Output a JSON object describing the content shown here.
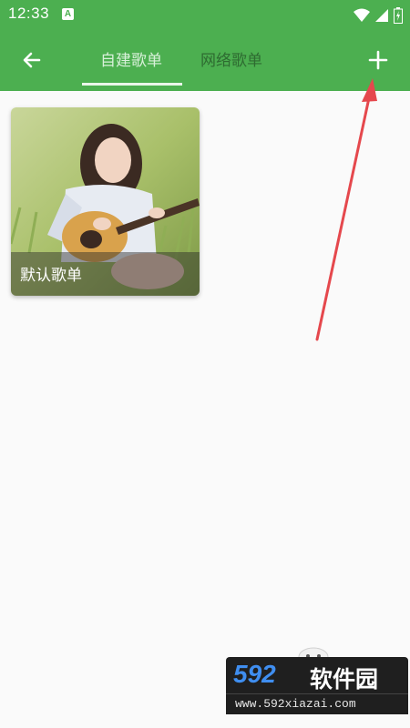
{
  "status_bar": {
    "time": "12:33",
    "notification_badge": "A",
    "icons": [
      "wifi-icon",
      "signal-icon",
      "battery-icon"
    ]
  },
  "toolbar": {
    "back_icon": "arrow-left-icon",
    "tabs": [
      {
        "label": "自建歌单",
        "active": true
      },
      {
        "label": "网络歌单",
        "active": false
      }
    ],
    "add_icon": "plus-icon"
  },
  "playlists": [
    {
      "title": "默认歌单",
      "cover": "girl-playing-guitar-photo"
    }
  ],
  "watermark": {
    "brand_number": "592",
    "brand_text": "软件园",
    "url": "www.592xiazai.com"
  },
  "colors": {
    "primary": "#4caf50",
    "annotation": "#e5484d",
    "background": "#fafafa"
  }
}
